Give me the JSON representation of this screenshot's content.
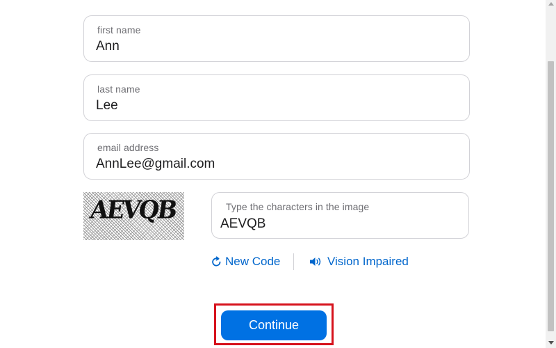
{
  "form": {
    "first_name": {
      "label": "first name",
      "value": "Ann"
    },
    "last_name": {
      "label": "last name",
      "value": "Lee"
    },
    "email": {
      "label": "email address",
      "value": "AnnLee@gmail.com"
    },
    "captcha": {
      "image_text": "AEVQB",
      "label": "Type the characters in the image",
      "value": "AEVQB"
    }
  },
  "links": {
    "new_code": {
      "label": "New Code",
      "icon": "refresh-icon"
    },
    "vision_impaired": {
      "label": "Vision Impaired",
      "icon": "speaker-icon"
    }
  },
  "continue_button": {
    "label": "Continue"
  },
  "colors": {
    "accent": "#0071e3",
    "link": "#0066cc",
    "highlight_border": "#d6121c"
  }
}
